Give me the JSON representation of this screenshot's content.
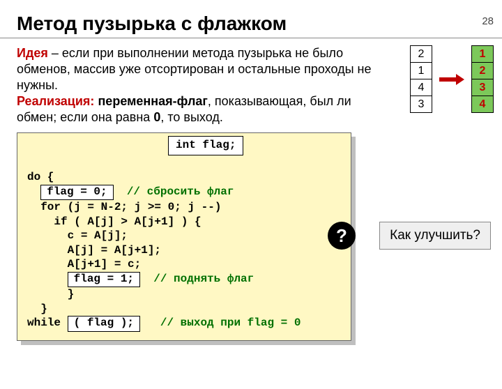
{
  "page_number": "28",
  "title": "Метод пузырька с флажком",
  "para1": {
    "lead": "Идея",
    "rest": " – если при выполнении метода пузырька не было обменов, массив уже отсортирован и остальные проходы не нужны."
  },
  "para2": {
    "lead": "Реализация:",
    "em": " переменная-флаг",
    "rest1": ", показывающая, был ли обмен; если она равна ",
    "zero": "0",
    "rest2": ", то выход."
  },
  "arrays": {
    "left": [
      "2",
      "1",
      "4",
      "3"
    ],
    "right": [
      "1",
      "2",
      "3",
      "4"
    ]
  },
  "code": {
    "flag_decl": "int flag;",
    "l1": "do {",
    "chip_flag0": "flag = 0;",
    "c_reset": "// сбросить флаг",
    "l3": "  for (j = N-2; j >= 0; j --)",
    "l4": "    if ( A[j] > A[j+1] ) {",
    "l5": "      c = A[j];",
    "l6": "      A[j] = A[j+1];",
    "l7": "      A[j+1] = c;",
    "chip_flag1": "flag = 1;",
    "c_raise": "// поднять флаг",
    "l9": "      }",
    "l10": "  }",
    "l11a": "while ",
    "chip_cond": "( flag );",
    "c_exit": "// выход при flag = 0"
  },
  "question": "Как улучшить?",
  "qmark": "?"
}
